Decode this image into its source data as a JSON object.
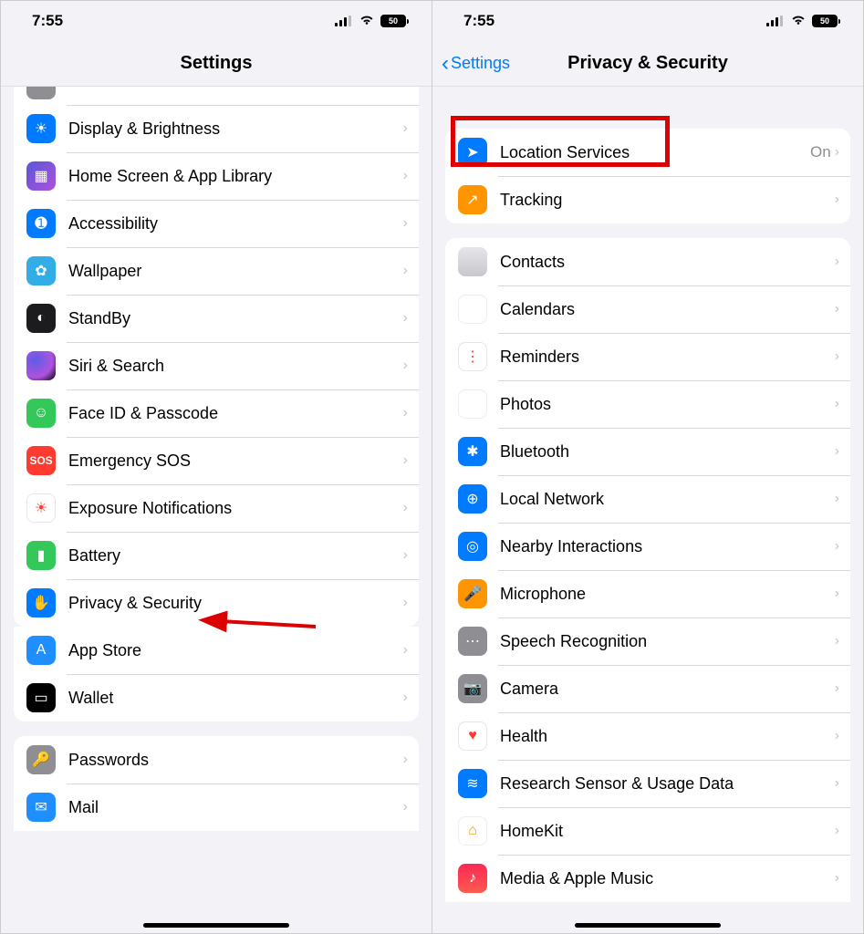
{
  "status": {
    "time": "7:55",
    "battery_level": "50"
  },
  "left": {
    "title": "Settings",
    "groups": [
      {
        "rows": [
          {
            "label": "Display & Brightness",
            "icon": "display-icon",
            "icon_class": "ic-blue"
          },
          {
            "label": "Home Screen & App Library",
            "icon": "home-screen-icon",
            "icon_class": "ic-apps"
          },
          {
            "label": "Accessibility",
            "icon": "accessibility-icon",
            "icon_class": "ic-blue"
          },
          {
            "label": "Wallpaper",
            "icon": "wallpaper-icon",
            "icon_class": "ic-teal"
          },
          {
            "label": "StandBy",
            "icon": "standby-icon",
            "icon_class": "ic-black"
          },
          {
            "label": "Siri & Search",
            "icon": "siri-icon",
            "icon_class": "ic-siri"
          },
          {
            "label": "Face ID & Passcode",
            "icon": "faceid-icon",
            "icon_class": "ic-green"
          },
          {
            "label": "Emergency SOS",
            "icon": "sos-icon",
            "icon_class": "ic-red",
            "icon_text": "SOS"
          },
          {
            "label": "Exposure Notifications",
            "icon": "exposure-icon",
            "icon_class": "ic-white"
          },
          {
            "label": "Battery",
            "icon": "battery-icon",
            "icon_class": "ic-green"
          },
          {
            "label": "Privacy & Security",
            "icon": "privacy-icon",
            "icon_class": "ic-blue"
          }
        ]
      },
      {
        "rows": [
          {
            "label": "App Store",
            "icon": "appstore-icon",
            "icon_class": "ic-appstore"
          },
          {
            "label": "Wallet",
            "icon": "wallet-icon",
            "icon_class": "ic-wallet"
          }
        ]
      },
      {
        "rows": [
          {
            "label": "Passwords",
            "icon": "passwords-icon",
            "icon_class": "ic-grey"
          },
          {
            "label": "Mail",
            "icon": "mail-icon",
            "icon_class": "ic-mail"
          }
        ]
      }
    ]
  },
  "right": {
    "back_label": "Settings",
    "title": "Privacy & Security",
    "groups": [
      {
        "rows": [
          {
            "label": "Location Services",
            "value": "On",
            "icon": "location-icon",
            "icon_class": "ic-blue"
          },
          {
            "label": "Tracking",
            "icon": "tracking-icon",
            "icon_class": "ic-orange"
          }
        ]
      },
      {
        "rows": [
          {
            "label": "Contacts",
            "icon": "contacts-icon",
            "icon_class": "ic-contacts"
          },
          {
            "label": "Calendars",
            "icon": "calendar-icon",
            "icon_class": "ic-calendar"
          },
          {
            "label": "Reminders",
            "icon": "reminders-icon",
            "icon_class": "ic-white"
          },
          {
            "label": "Photos",
            "icon": "photos-icon",
            "icon_class": "ic-photos"
          },
          {
            "label": "Bluetooth",
            "icon": "bluetooth-icon",
            "icon_class": "ic-blue"
          },
          {
            "label": "Local Network",
            "icon": "network-icon",
            "icon_class": "ic-blue"
          },
          {
            "label": "Nearby Interactions",
            "icon": "nearby-icon",
            "icon_class": "ic-blue"
          },
          {
            "label": "Microphone",
            "icon": "microphone-icon",
            "icon_class": "ic-orange"
          },
          {
            "label": "Speech Recognition",
            "icon": "speech-icon",
            "icon_class": "ic-grey"
          },
          {
            "label": "Camera",
            "icon": "camera-icon",
            "icon_class": "ic-grey"
          },
          {
            "label": "Health",
            "icon": "health-icon",
            "icon_class": "ic-white"
          },
          {
            "label": "Research Sensor & Usage Data",
            "icon": "research-icon",
            "icon_class": "ic-blue"
          },
          {
            "label": "HomeKit",
            "icon": "homekit-icon",
            "icon_class": "ic-home"
          },
          {
            "label": "Media & Apple Music",
            "icon": "music-icon",
            "icon_class": "ic-music"
          }
        ]
      }
    ]
  }
}
